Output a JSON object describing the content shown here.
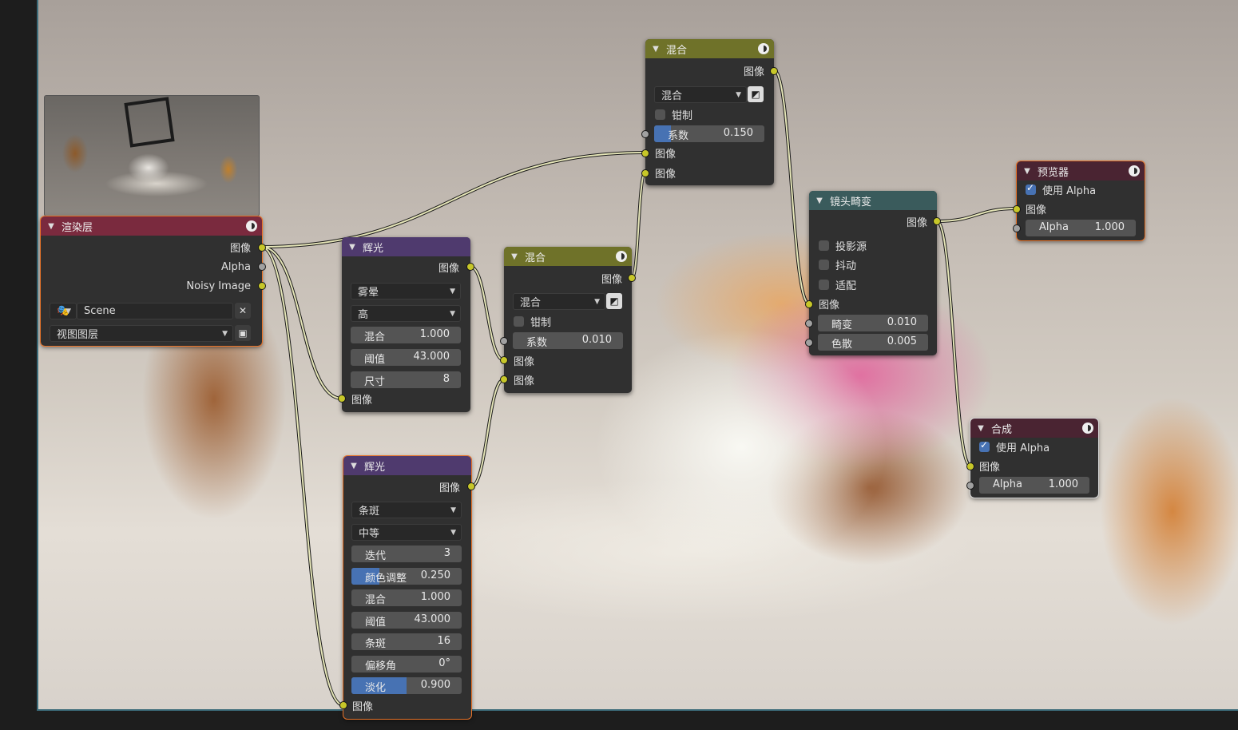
{
  "editor": {
    "backdrop_name": "compositor-backdrop"
  },
  "render_layers": {
    "title": "渲染层",
    "outputs": [
      "图像",
      "Alpha",
      "Noisy Image"
    ],
    "scene": "Scene",
    "view_layer": "视图图层"
  },
  "glare1": {
    "title": "辉光",
    "output": "图像",
    "type": "雾晕",
    "quality": "高",
    "mix_label": "混合",
    "mix_value": "1.000",
    "threshold_label": "阈值",
    "threshold_value": "43.000",
    "size_label": "尺寸",
    "size_value": "8",
    "input": "图像"
  },
  "glare2": {
    "title": "辉光",
    "output": "图像",
    "type": "条斑",
    "quality": "中等",
    "iterations_label": "迭代",
    "iterations_value": "3",
    "color_mod_label": "颜色调整",
    "color_mod_value": "0.250",
    "color_mod_fraction": 0.25,
    "mix_label": "混合",
    "mix_value": "1.000",
    "threshold_label": "阈值",
    "threshold_value": "43.000",
    "streaks_label": "条斑",
    "streaks_value": "16",
    "angle_label": "偏移角",
    "angle_value": "0°",
    "fade_label": "淡化",
    "fade_value": "0.900",
    "fade_fraction": 0.5,
    "input": "图像"
  },
  "mix1": {
    "title": "混合",
    "output": "图像",
    "blend": "混合",
    "clamp": "钳制",
    "fac_label": "系数",
    "fac_value": "0.010",
    "input1": "图像",
    "input2": "图像"
  },
  "mix2": {
    "title": "混合",
    "output": "图像",
    "blend": "混合",
    "clamp": "钳制",
    "fac_label": "系数",
    "fac_value": "0.150",
    "fac_fraction": 0.15,
    "input1": "图像",
    "input2": "图像"
  },
  "lens": {
    "title": "镜头畸变",
    "output": "图像",
    "projector": "投影源",
    "jitter": "抖动",
    "fit": "适配",
    "input": "图像",
    "distort_label": "畸变",
    "distort_value": "0.010",
    "dispersion_label": "色散",
    "dispersion_value": "0.005"
  },
  "viewer": {
    "title": "预览器",
    "use_alpha": "使用 Alpha",
    "input": "图像",
    "alpha_label": "Alpha",
    "alpha_value": "1.000"
  },
  "composite": {
    "title": "合成",
    "use_alpha": "使用 Alpha",
    "input": "图像",
    "alpha_label": "Alpha",
    "alpha_value": "1.000"
  },
  "colors": {
    "image_socket": "#c7c729",
    "value_socket": "#a1a1a1",
    "slider_fill": "#4772b3",
    "selected_outline": "#e8742a",
    "render_layers_header": "#7a2a3e",
    "filter_header": "#4f3a6e",
    "color_header": "#6f7229",
    "distort_header": "#3a5b5c",
    "output_header": "#4a2432"
  }
}
